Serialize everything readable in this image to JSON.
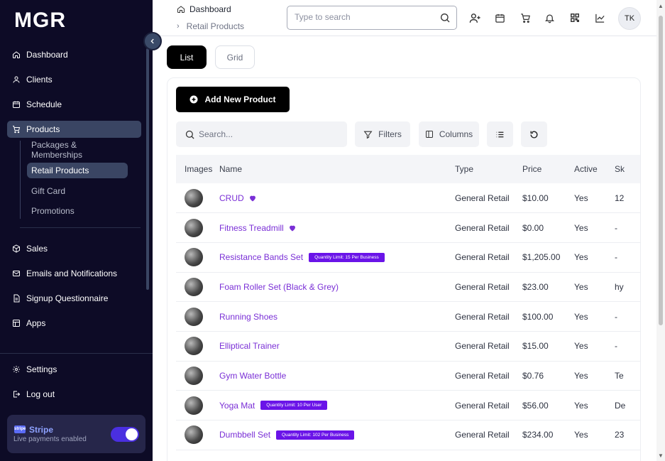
{
  "app": {
    "logo": "MGR"
  },
  "sidebar": {
    "items": [
      {
        "label": "Dashboard",
        "icon": "home-icon"
      },
      {
        "label": "Clients",
        "icon": "user-icon"
      },
      {
        "label": "Schedule",
        "icon": "calendar-icon"
      },
      {
        "label": "Products",
        "icon": "cart-icon",
        "active": true
      },
      {
        "label": "Sales",
        "icon": "box-icon"
      },
      {
        "label": "Emails and Notifications",
        "icon": "mail-icon"
      },
      {
        "label": "Signup Questionnaire",
        "icon": "file-icon"
      },
      {
        "label": "Apps",
        "icon": "apps-icon"
      },
      {
        "label": "Settings",
        "icon": "gear-icon"
      },
      {
        "label": "Log out",
        "icon": "logout-icon"
      }
    ],
    "subitems": [
      {
        "label": "Packages & Memberships"
      },
      {
        "label": "Retail Products",
        "active": true
      },
      {
        "label": "Gift Card"
      },
      {
        "label": "Promotions"
      }
    ],
    "stripe": {
      "logo": "stripe",
      "title": "Stripe",
      "subtitle": "Live payments enabled",
      "enabled": true
    }
  },
  "header": {
    "breadcrumb": [
      "Dashboard",
      "Retail Products"
    ],
    "search_placeholder": "Type to search",
    "avatar_initials": "TK"
  },
  "tabs": [
    "List",
    "Grid"
  ],
  "toolbar": {
    "add_label": "Add New Product",
    "search_placeholder": "Search...",
    "filters_label": "Filters",
    "columns_label": "Columns"
  },
  "table": {
    "columns": [
      "Images",
      "Name",
      "Type",
      "Price",
      "Active",
      "Sk"
    ],
    "rows": [
      {
        "name": "CRUD",
        "heart": true,
        "badge": "",
        "type": "General Retail",
        "price": "$10.00",
        "active": "Yes",
        "sku": "12"
      },
      {
        "name": "Fitness Treadmill",
        "heart": true,
        "badge": "",
        "type": "General Retail",
        "price": "$0.00",
        "active": "Yes",
        "sku": "-"
      },
      {
        "name": "Resistance Bands Set",
        "heart": false,
        "badge": "Quantity Limit: 15 Per Business",
        "type": "General Retail",
        "price": "$1,205.00",
        "active": "Yes",
        "sku": "-"
      },
      {
        "name": "Foam Roller Set (Black & Grey)",
        "heart": false,
        "badge": "",
        "type": "General Retail",
        "price": "$23.00",
        "active": "Yes",
        "sku": "hy"
      },
      {
        "name": "Running Shoes",
        "heart": false,
        "badge": "",
        "type": "General Retail",
        "price": "$100.00",
        "active": "Yes",
        "sku": "-"
      },
      {
        "name": "Elliptical Trainer",
        "heart": false,
        "badge": "",
        "type": "General Retail",
        "price": "$15.00",
        "active": "Yes",
        "sku": "-"
      },
      {
        "name": "Gym Water Bottle",
        "heart": false,
        "badge": "",
        "type": "General Retail",
        "price": "$0.76",
        "active": "Yes",
        "sku": "Te"
      },
      {
        "name": "Yoga Mat",
        "heart": false,
        "badge": "Quantity Limit: 10 Per User",
        "type": "General Retail",
        "price": "$56.00",
        "active": "Yes",
        "sku": "De"
      },
      {
        "name": "Dumbbell Set",
        "heart": false,
        "badge": "Quantity Limit: 102 Per Business",
        "type": "General Retail",
        "price": "$234.00",
        "active": "Yes",
        "sku": "23"
      }
    ]
  },
  "colors": {
    "sidebar_bg": "#0d0b26",
    "accent": "#7a2fd6",
    "badge": "#6a14e8",
    "active_item": "#3a4563"
  }
}
